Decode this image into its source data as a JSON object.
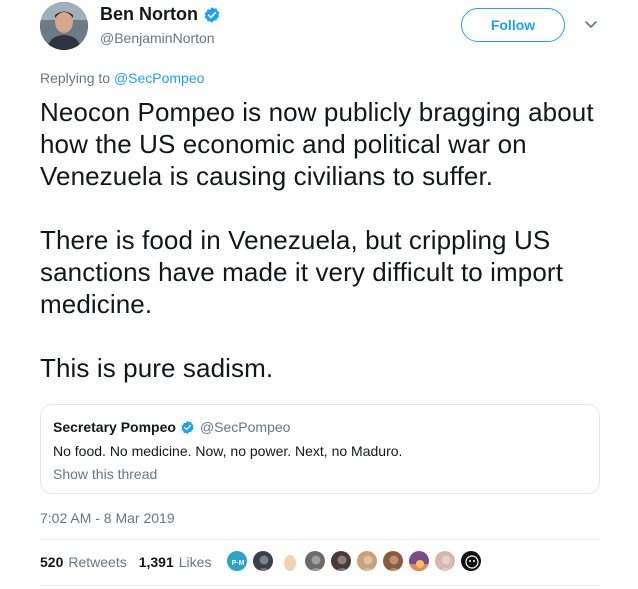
{
  "author": {
    "display_name": "Ben Norton",
    "handle": "@BenjaminNorton",
    "verified": true
  },
  "follow_label": "Follow",
  "reply": {
    "prefix": "Replying to",
    "handle": "@SecPompeo"
  },
  "tweet": {
    "paragraphs": [
      "Neocon Pompeo is now publicly bragging about how the US economic and political war on Venezuela is causing civilians to suffer.",
      "There is food in Venezuela, but crippling US sanctions have made it very difficult to import medicine.",
      "This is pure sadism."
    ]
  },
  "quote": {
    "name": "Secretary Pompeo",
    "handle": "@SecPompeo",
    "verified": true,
    "text": "No food. No medicine. Now, no power. Next, no Maduro.",
    "show_thread": "Show this thread"
  },
  "timestamp": "7:02 AM - 8 Mar 2019",
  "stats": {
    "retweets": "520",
    "retweets_label": "Retweets",
    "likes": "1,391",
    "likes_label": "Likes"
  },
  "likers": [
    {
      "icon": "pm-logo-avatar",
      "color": "#2aa4c9"
    },
    {
      "icon": "user-avatar",
      "color": "#3a3f4a"
    },
    {
      "icon": "egg-avatar",
      "color": "#f1d3b4"
    },
    {
      "icon": "user-avatar",
      "color": "#6b6b6b"
    },
    {
      "icon": "user-avatar",
      "color": "#4a3a36"
    },
    {
      "icon": "user-avatar",
      "color": "#c9a27a"
    },
    {
      "icon": "user-avatar",
      "color": "#8e5b3a"
    },
    {
      "icon": "sunset-avatar",
      "color": "#7a4b8c"
    },
    {
      "icon": "user-avatar",
      "color": "#d7b8b0"
    },
    {
      "icon": "sketch-avatar",
      "color": "#111111"
    }
  ],
  "colors": {
    "accent": "#1da1f2",
    "muted": "#657786",
    "text": "#14171a",
    "border": "#e1e8ed"
  }
}
